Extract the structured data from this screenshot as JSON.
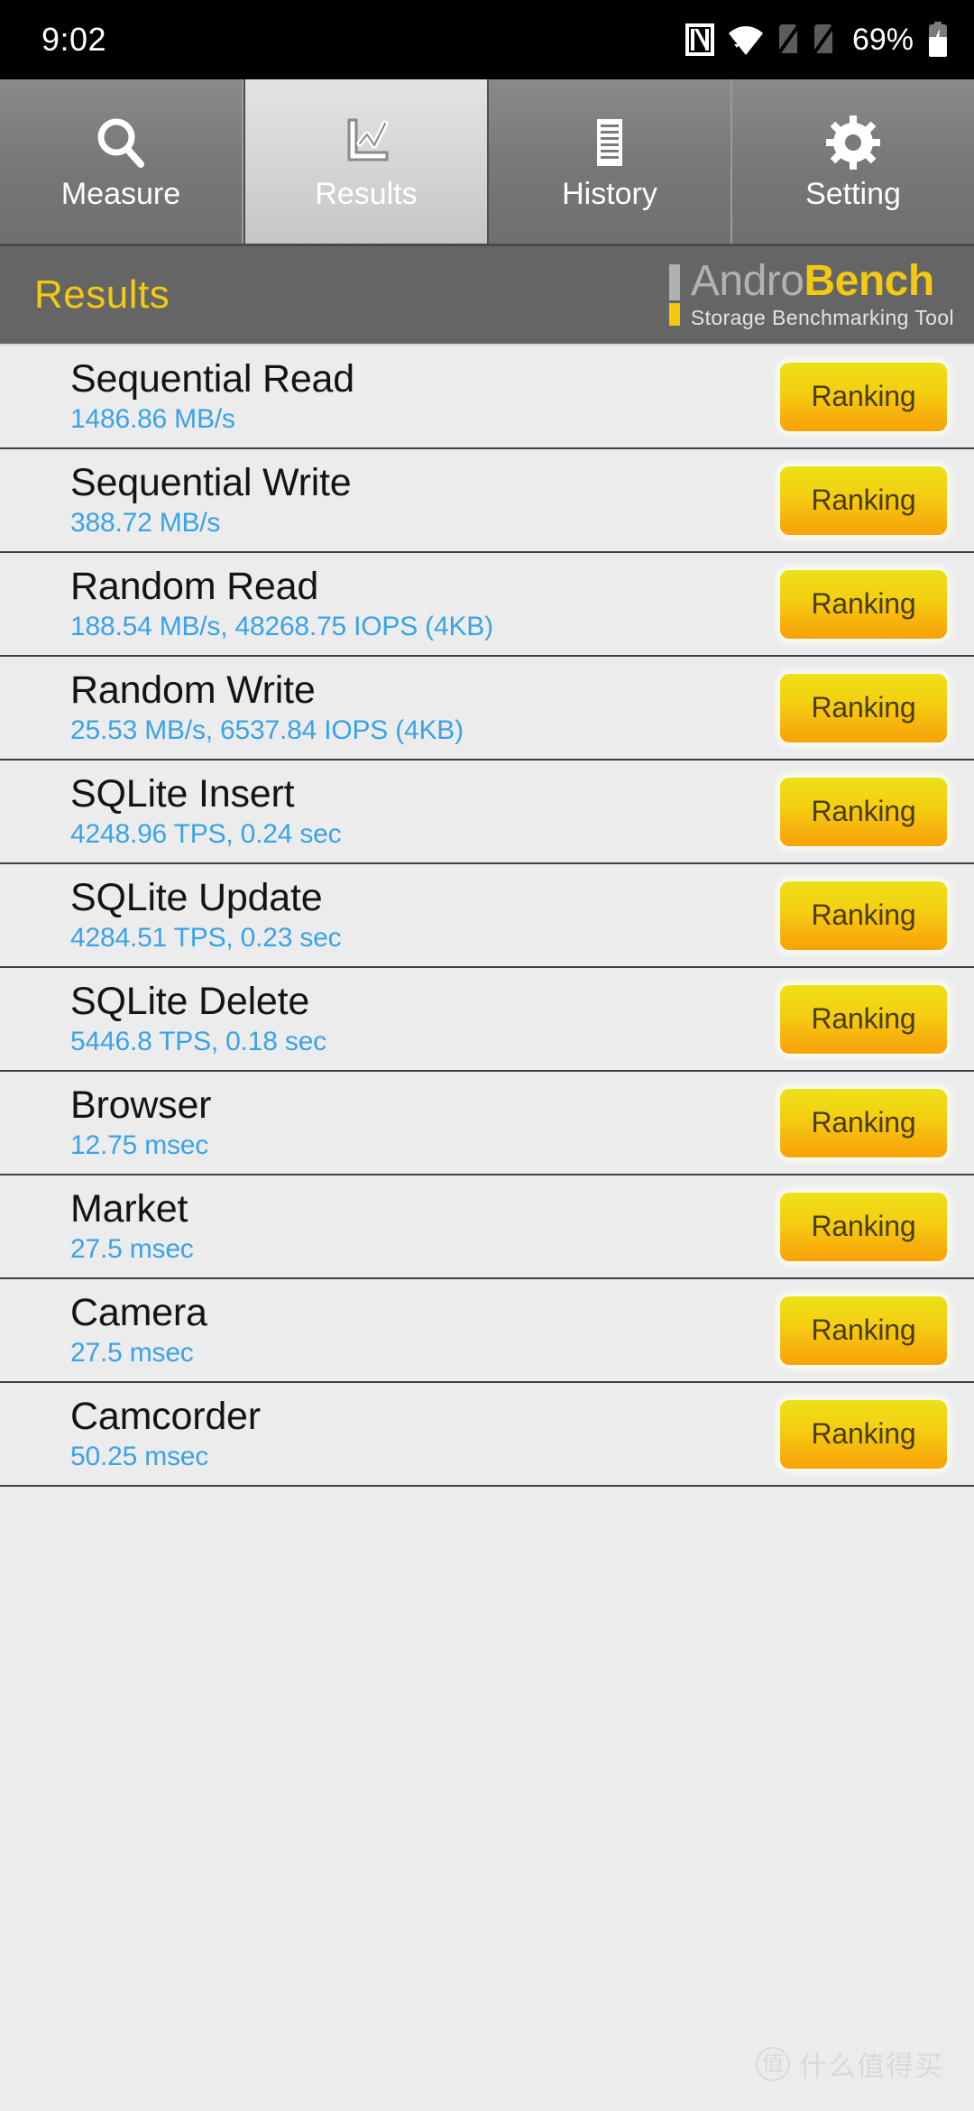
{
  "status_bar": {
    "time": "9:02",
    "battery_percent": "69%",
    "icons": [
      "nfc-icon",
      "wifi-icon",
      "signal-off-icon",
      "signal-off-icon",
      "battery-charging-icon"
    ]
  },
  "tabs": [
    {
      "label": "Measure",
      "icon": "magnifier-icon",
      "active": false
    },
    {
      "label": "Results",
      "icon": "line-chart-icon",
      "active": true
    },
    {
      "label": "History",
      "icon": "list-document-icon",
      "active": false
    },
    {
      "label": "Setting",
      "icon": "gear-icon",
      "active": false
    }
  ],
  "header": {
    "title": "Results",
    "brand_andro": "Andro",
    "brand_bench": "Bench",
    "brand_subtitle": "Storage Benchmarking Tool"
  },
  "colors": {
    "accent_yellow": "#f3c911",
    "value_blue": "#3aa3e8",
    "header_gray": "#656565",
    "list_bg": "#ececed",
    "button_top": "#ede116",
    "button_bottom": "#f9a207"
  },
  "results": [
    {
      "title": "Sequential Read",
      "value": "1486.86 MB/s",
      "button": "Ranking"
    },
    {
      "title": "Sequential Write",
      "value": "388.72 MB/s",
      "button": "Ranking"
    },
    {
      "title": "Random Read",
      "value": "188.54 MB/s, 48268.75 IOPS (4KB)",
      "button": "Ranking"
    },
    {
      "title": "Random Write",
      "value": "25.53 MB/s, 6537.84 IOPS (4KB)",
      "button": "Ranking"
    },
    {
      "title": "SQLite Insert",
      "value": "4248.96 TPS, 0.24 sec",
      "button": "Ranking"
    },
    {
      "title": "SQLite Update",
      "value": "4284.51 TPS, 0.23 sec",
      "button": "Ranking"
    },
    {
      "title": "SQLite Delete",
      "value": "5446.8 TPS, 0.18 sec",
      "button": "Ranking"
    },
    {
      "title": "Browser",
      "value": "12.75 msec",
      "button": "Ranking"
    },
    {
      "title": "Market",
      "value": "27.5 msec",
      "button": "Ranking"
    },
    {
      "title": "Camera",
      "value": "27.5 msec",
      "button": "Ranking"
    },
    {
      "title": "Camcorder",
      "value": "50.25 msec",
      "button": "Ranking"
    }
  ],
  "watermark": {
    "logo_char": "值",
    "text": "什么值得买"
  }
}
